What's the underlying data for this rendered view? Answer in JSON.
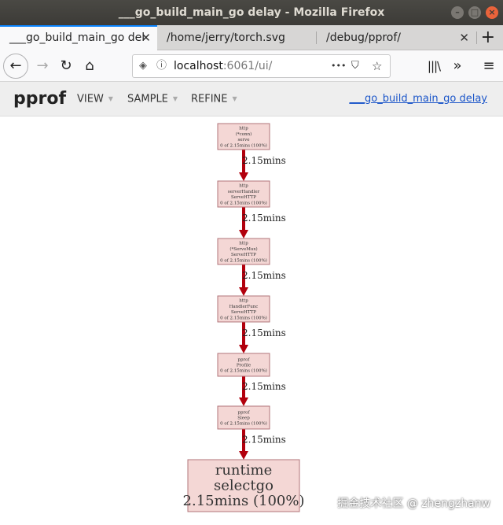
{
  "window": {
    "title": "___go_build_main_go delay - Mozilla Firefox"
  },
  "tabs": [
    {
      "label": "___go_build_main_go del",
      "active": true
    },
    {
      "label": "/home/jerry/torch.svg",
      "active": false
    },
    {
      "label": "/debug/pprof/",
      "active": false
    }
  ],
  "nav": {
    "url_host": "localhost",
    "url_rest": ":6061/ui/",
    "overflow_label": "•••"
  },
  "pprof": {
    "title": "pprof",
    "menus": [
      "VIEW",
      "SAMPLE",
      "REFINE"
    ],
    "profile_link": "___go_build_main_go delay"
  },
  "graph": {
    "edge_color": "#b2000d",
    "node_fill": "#f4d7d5",
    "node_border": "#b2747a",
    "nodes": [
      {
        "lines": [
          "http",
          "(*conn)",
          "serve",
          "0 of 2.15mins (100%)"
        ]
      },
      {
        "lines": [
          "http",
          "serverHandler",
          "ServeHTTP",
          "0 of 2.15mins (100%)"
        ]
      },
      {
        "lines": [
          "http",
          "(*ServeMux)",
          "ServeHTTP",
          "0 of 2.15mins (100%)"
        ]
      },
      {
        "lines": [
          "http",
          "HandlerFunc",
          "ServeHTTP",
          "0 of 2.15mins (100%)"
        ]
      },
      {
        "lines": [
          "pprof",
          "Profile",
          "0 of 2.15mins (100%)"
        ]
      },
      {
        "lines": [
          "pprof",
          "Sleep",
          "0 of 2.15mins (100%)"
        ]
      },
      {
        "lines": [
          "runtime",
          "selectgo",
          "2.15mins (100%)"
        ]
      }
    ],
    "edges": [
      "2.15mins",
      "2.15mins",
      "2.15mins",
      "2.15mins",
      "2.15mins",
      "2.15mins"
    ]
  },
  "watermark": "掘金技术社区 @ zhengzhanw"
}
